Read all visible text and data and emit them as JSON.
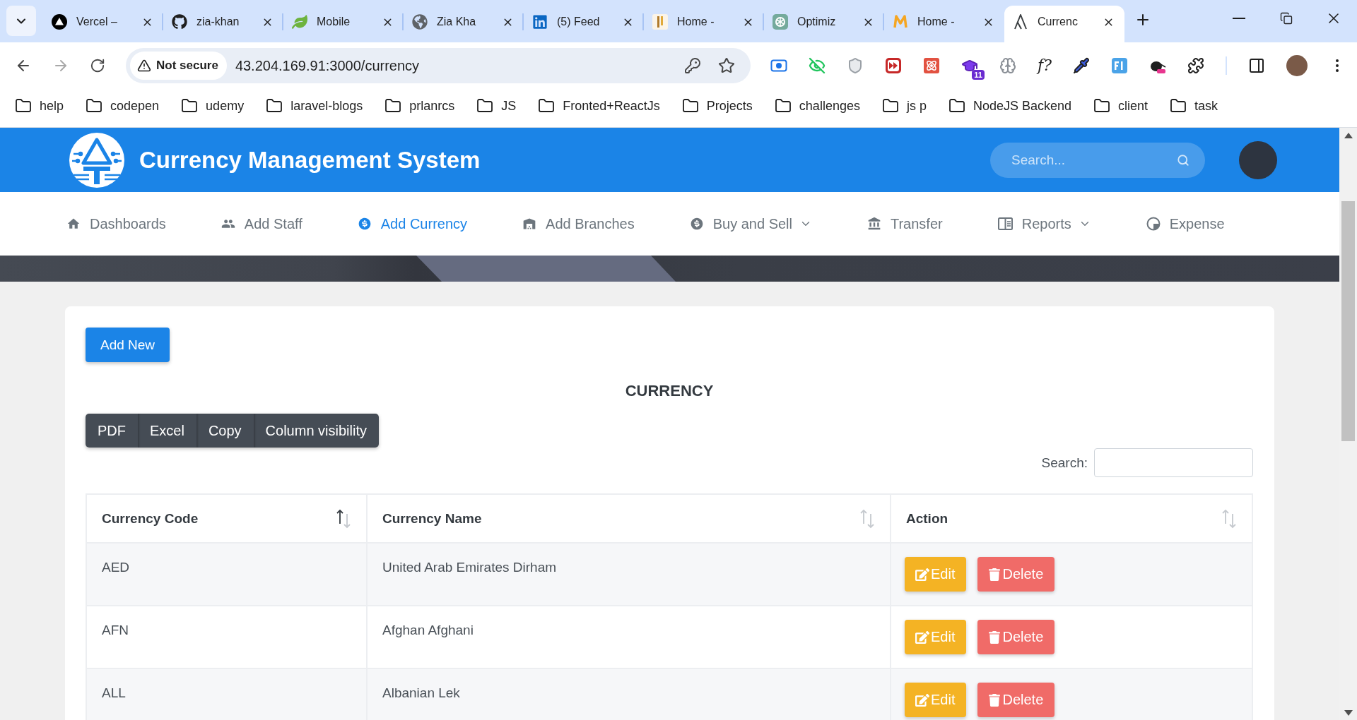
{
  "browser": {
    "tabs": [
      {
        "title": "Vercel –",
        "selected": false
      },
      {
        "title": "zia-khan",
        "selected": false
      },
      {
        "title": "Mobile",
        "selected": false
      },
      {
        "title": "Zia Kha",
        "selected": false
      },
      {
        "title": "(5) Feed",
        "selected": false
      },
      {
        "title": "Home -",
        "selected": false
      },
      {
        "title": "Optimiz",
        "selected": false
      },
      {
        "title": "Home -",
        "selected": false
      },
      {
        "title": "Currenc",
        "selected": true
      }
    ],
    "address_bar": {
      "security_label": "Not secure",
      "url": "43.204.169.91:3000/currency"
    },
    "extensions": {
      "badge": "11",
      "glyph": "f?"
    },
    "bookmarks": [
      "help",
      "codepen",
      "udemy",
      "laravel-blogs",
      "prlanrcs",
      "JS",
      "Fronted+ReactJs",
      "Projects",
      "challenges",
      "js p",
      "NodeJS Backend",
      "client",
      "task"
    ]
  },
  "header": {
    "title": "Currency Management System",
    "search": {
      "placeholder": "Search..."
    }
  },
  "nav": [
    {
      "label": "Dashboards",
      "selected": false,
      "dropdown": false
    },
    {
      "label": "Add Staff",
      "selected": false,
      "dropdown": false
    },
    {
      "label": "Add Currency",
      "selected": true,
      "dropdown": false
    },
    {
      "label": "Add Branches",
      "selected": false,
      "dropdown": false
    },
    {
      "label": "Buy and Sell",
      "selected": false,
      "dropdown": true
    },
    {
      "label": "Transfer",
      "selected": false,
      "dropdown": false
    },
    {
      "label": "Reports",
      "selected": false,
      "dropdown": true
    },
    {
      "label": "Expense",
      "selected": false,
      "dropdown": false
    }
  ],
  "content": {
    "add_button": "Add New",
    "heading": "CURRENCY",
    "export_buttons": [
      "PDF",
      "Excel",
      "Copy",
      "Column visibility"
    ],
    "search": {
      "label": "Search:"
    },
    "table": {
      "columns": [
        {
          "label": "Currency Code",
          "sorted": true
        },
        {
          "label": "Currency Name",
          "sorted": false
        },
        {
          "label": "Action",
          "sorted": false
        }
      ],
      "rows": [
        {
          "code": "AED",
          "name": "United Arab Emirates Dirham",
          "actions": [
            {
              "kind": "edit",
              "label": "Edit"
            },
            {
              "kind": "delete",
              "label": "Delete"
            }
          ]
        },
        {
          "code": "AFN",
          "name": "Afghan Afghani",
          "actions": [
            {
              "kind": "edit",
              "label": "Edit"
            },
            {
              "kind": "delete",
              "label": "Delete"
            }
          ]
        },
        {
          "code": "ALL",
          "name": "Albanian Lek",
          "actions": [
            {
              "kind": "edit",
              "label": "Edit"
            },
            {
              "kind": "delete",
              "label": "Delete"
            }
          ]
        }
      ]
    }
  }
}
